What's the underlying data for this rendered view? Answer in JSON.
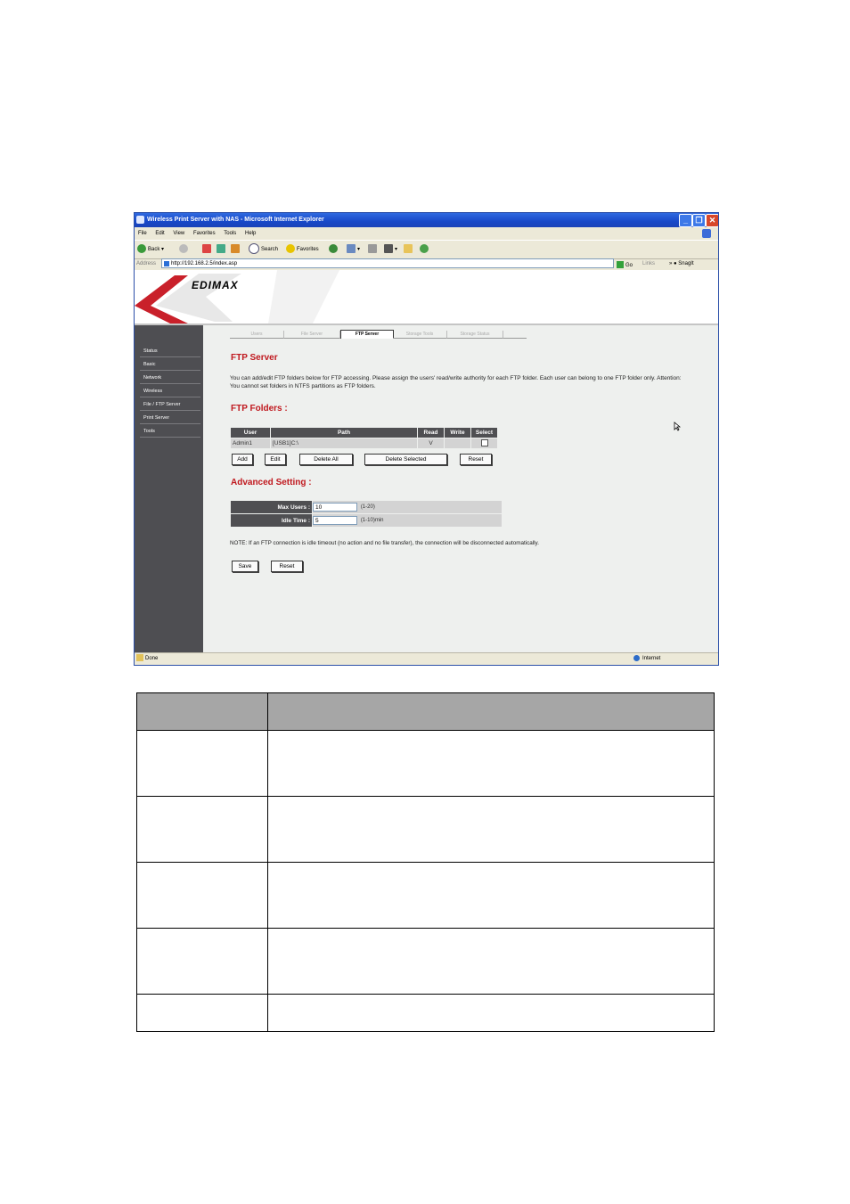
{
  "window": {
    "title": "Wireless Print Server with NAS - Microsoft Internet Explorer",
    "controls": [
      "_",
      "❐",
      "✕"
    ]
  },
  "menubar": [
    "File",
    "Edit",
    "View",
    "Favorites",
    "Tools",
    "Help"
  ],
  "toolbar": {
    "back": "Back",
    "search": "Search",
    "favorites": "Favorites"
  },
  "address": {
    "label": "Address",
    "url": "http://192.168.2.5/index.asp",
    "go": "Go",
    "links": "Links",
    "snagit": "SnagIt"
  },
  "brand": {
    "logo": "EDIMAX"
  },
  "sidebar": [
    "Status",
    "Basic",
    "Network",
    "Wireless",
    "File / FTP Server",
    "Print Server",
    "Tools"
  ],
  "tabs": [
    "Users",
    "File Server",
    "FTP Server",
    "Storage Tools",
    "Storage Status"
  ],
  "active_tab": "FTP Server",
  "ftp_server": {
    "title": "FTP Server",
    "description": "You can add/edit FTP folders below for FTP accessing. Please assign the users' read/write authority for each FTP folder. Each user can belong to one FTP folder only. Attention: You cannot set folders in NTFS partitions as FTP folders.",
    "folders_title": "FTP Folders :",
    "columns": [
      "User",
      "Path",
      "Read",
      "Write",
      "Select"
    ],
    "rows": [
      {
        "user": "Admin1",
        "path": "[USB1]C:\\",
        "read": "V",
        "write": "",
        "select": false
      }
    ],
    "buttons": [
      "Add",
      "Edit",
      "Delete All",
      "Delete Selected",
      "Reset"
    ]
  },
  "advanced": {
    "title": "Advanced Setting :",
    "max_users_label": "Max Users :",
    "max_users_value": "10",
    "max_users_hint": "(1-20)",
    "idle_time_label": "Idle Time :",
    "idle_time_value": "5",
    "idle_time_hint": "(1-10)min",
    "note": "NOTE: If an FTP connection is idle timeout (no action and no file transfer), the connection will be disconnected automatically.",
    "save": "Save",
    "reset": "Reset"
  },
  "status": {
    "left": "Done",
    "right": "Internet"
  },
  "colors": {
    "title_bar": "#1848c8",
    "sidebar": "#4e4e52",
    "heading_red": "#c0181e",
    "table_header": "#4f4f52",
    "doc_table_header": "#a6a6a6"
  }
}
